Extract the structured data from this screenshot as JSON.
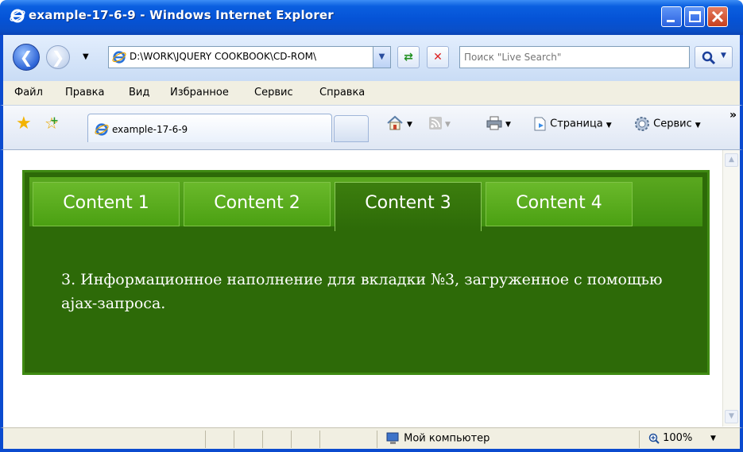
{
  "window": {
    "title": "example-17-6-9 - Windows Internet Explorer"
  },
  "address_bar": {
    "url": "D:\\WORK\\JQUERY COOKBOOK\\CD-ROM\\",
    "search_placeholder": "Поиск \"Live Search\""
  },
  "menu": {
    "items": [
      "Файл",
      "Правка",
      "Вид",
      "Избранное",
      "Сервис",
      "Справка"
    ]
  },
  "browser_tab": {
    "label": "example-17-6-9"
  },
  "command_bar": {
    "page_label": "Страница",
    "tools_label": "Сервис"
  },
  "page": {
    "tabs": [
      {
        "label": "Content 1",
        "active": false
      },
      {
        "label": "Content 2",
        "active": false
      },
      {
        "label": "Content 3",
        "active": true
      },
      {
        "label": "Content 4",
        "active": false
      }
    ],
    "panel_text": "3. Информационное наполнение для вкладки №3, загруженное с помощью ajax-запроса."
  },
  "status_bar": {
    "zone": "Мой компьютер",
    "zoom": "100%"
  },
  "colors": {
    "titlebar": "#0553d6",
    "widget_bg": "#2d6a08",
    "tab_green": "#4ba012"
  }
}
